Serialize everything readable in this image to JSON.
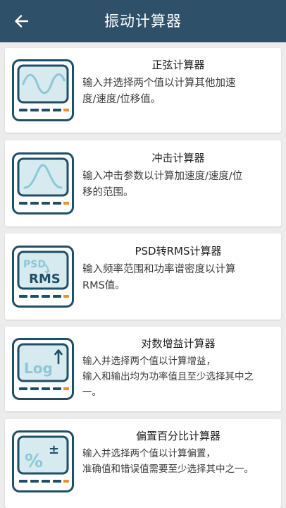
{
  "header": {
    "title": "振动计算器",
    "back_icon": "arrow-left-icon"
  },
  "colors": {
    "header_bg": "#2e5069",
    "icon_frame": "#1f4e67",
    "icon_screen": "#d6eaf0",
    "accent": "#e8912b"
  },
  "calculators": [
    {
      "title": "正弦计算器",
      "desc_lines": [
        "输入并选择两个值以计算其他加速",
        "度/速度/位移值。"
      ],
      "icon": "sine-wave-icon"
    },
    {
      "title": "冲击计算器",
      "desc_lines": [
        "输入冲击参数以计算加速度/速度/位",
        "移的范围。"
      ],
      "icon": "shock-pulse-icon"
    },
    {
      "title": "PSD转RMS计算器",
      "desc_lines": [
        "输入频率范围和功率谱密度以计算",
        "RMS值。"
      ],
      "icon": "psd-rms-icon",
      "icon_text": {
        "top": "PSD",
        "bottom": "RMS"
      }
    },
    {
      "title": "对数增益计算器",
      "desc_lines": [
        "输入并选择两个值以计算增益，",
        "输入和输出均为功率值且至少选择其中之",
        "一。"
      ],
      "icon": "log-gain-icon",
      "icon_text": {
        "main": "Log"
      }
    },
    {
      "title": "偏置百分比计算器",
      "desc_lines": [
        "输入并选择两个值以计算偏置，",
        "准确值和错误值需要至少选择其中之一。"
      ],
      "icon": "percent-bias-icon",
      "icon_text": {
        "main": "%",
        "sub": "±"
      }
    }
  ]
}
